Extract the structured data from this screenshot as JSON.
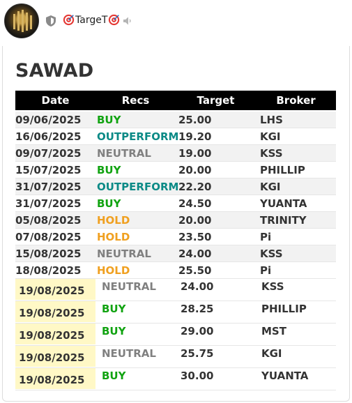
{
  "channel": {
    "name": "TargeT",
    "icons": [
      "shield-icon",
      "target-icon",
      "speaker-muted-icon"
    ]
  },
  "title": "SAWAD",
  "table": {
    "headers": [
      "Date",
      "Recs",
      "Target",
      "Broker"
    ],
    "rows": [
      {
        "date": "09/06/2025",
        "rec": "BUY",
        "target": "25.00",
        "broker": "LHS",
        "highlight": false
      },
      {
        "date": "16/06/2025",
        "rec": "OUTPERFORM",
        "target": "19.20",
        "broker": "KGI",
        "highlight": false
      },
      {
        "date": "09/07/2025",
        "rec": "NEUTRAL",
        "target": "19.00",
        "broker": "KSS",
        "highlight": false
      },
      {
        "date": "15/07/2025",
        "rec": "BUY",
        "target": "20.00",
        "broker": "PHILLIP",
        "highlight": false
      },
      {
        "date": "31/07/2025",
        "rec": "OUTPERFORM",
        "target": "22.20",
        "broker": "KGI",
        "highlight": false
      },
      {
        "date": "31/07/2025",
        "rec": "BUY",
        "target": "24.50",
        "broker": "YUANTA",
        "highlight": false
      },
      {
        "date": "05/08/2025",
        "rec": "HOLD",
        "target": "20.00",
        "broker": "TRINITY",
        "highlight": false
      },
      {
        "date": "07/08/2025",
        "rec": "HOLD",
        "target": "23.50",
        "broker": "Pi",
        "highlight": false
      },
      {
        "date": "15/08/2025",
        "rec": "NEUTRAL",
        "target": "24.00",
        "broker": "KSS",
        "highlight": false
      },
      {
        "date": "18/08/2025",
        "rec": "HOLD",
        "target": "25.50",
        "broker": "Pi",
        "highlight": false
      },
      {
        "date": "19/08/2025",
        "rec": "NEUTRAL",
        "target": "24.00",
        "broker": "KSS",
        "highlight": true
      },
      {
        "date": "19/08/2025",
        "rec": "BUY",
        "target": "28.25",
        "broker": "PHILLIP",
        "highlight": true
      },
      {
        "date": "19/08/2025",
        "rec": "BUY",
        "target": "29.00",
        "broker": "MST",
        "highlight": true
      },
      {
        "date": "19/08/2025",
        "rec": "NEUTRAL",
        "target": "25.75",
        "broker": "KGI",
        "highlight": true
      },
      {
        "date": "19/08/2025",
        "rec": "BUY",
        "target": "30.00",
        "broker": "YUANTA",
        "highlight": true
      }
    ]
  },
  "colors": {
    "BUY": "#11a311",
    "OUTPERFORM": "#0b8a86",
    "NEUTRAL": "#808080",
    "HOLD": "#f0a020",
    "highlight": "#fff8c6",
    "row_alt": "#f2f2f2"
  }
}
